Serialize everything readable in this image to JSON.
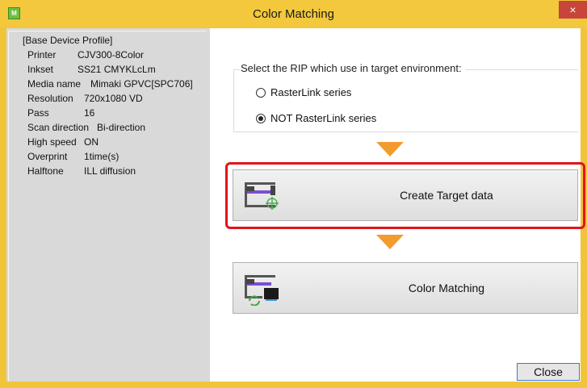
{
  "window": {
    "title": "Color Matching",
    "close_glyph": "×",
    "app_icon_text": "M"
  },
  "profile": {
    "header": "[Base Device Profile]",
    "rows": [
      {
        "key": "Printer",
        "value": "CJV300-8Color"
      },
      {
        "key": "Inkset",
        "value": "SS21 CMYKLcLm"
      },
      {
        "key": "Media name",
        "value": "Mimaki GPVC[SPC706]"
      },
      {
        "key": "Resolution",
        "value": "720x1080 VD"
      },
      {
        "key": "Pass",
        "value": "16"
      },
      {
        "key": "Scan direction",
        "value": "Bi-direction"
      },
      {
        "key": "High speed",
        "value": "ON"
      },
      {
        "key": "Overprint",
        "value": "1time(s)"
      },
      {
        "key": "Halftone",
        "value": "ILL diffusion"
      }
    ]
  },
  "rip_group": {
    "legend": "Select the RIP which use in target environment:",
    "options": [
      {
        "label": "RasterLink series",
        "selected": false
      },
      {
        "label": "NOT RasterLink series",
        "selected": true
      }
    ]
  },
  "buttons": {
    "create_target": "Create Target data",
    "color_matching": "Color Matching",
    "close": "Close"
  },
  "colors": {
    "titlebar": "#f3c83c",
    "arrow": "#f29c2e",
    "highlight": "#e3141a",
    "panel": "#d9d9d9"
  },
  "icons": {
    "create_target": "printer-target-icon",
    "color_matching": "printer-refresh-icon"
  }
}
